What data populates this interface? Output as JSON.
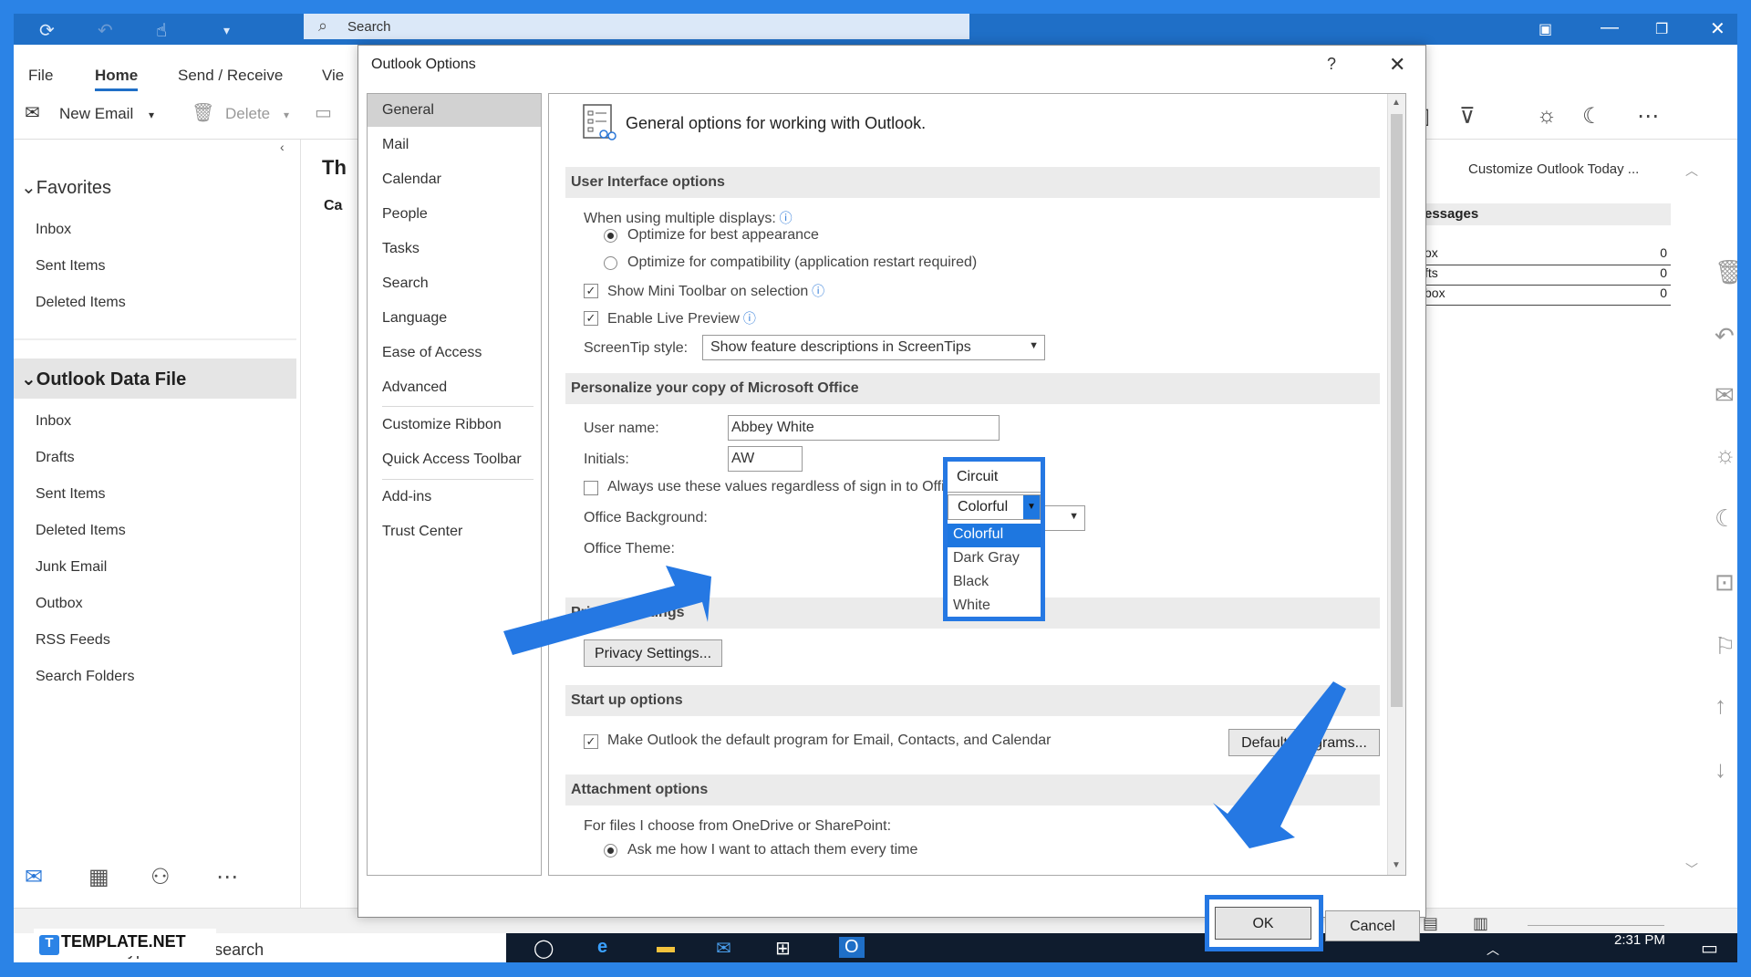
{
  "titlebar": {
    "search_placeholder": "Search"
  },
  "ribbon": {
    "tabs": [
      "File",
      "Home",
      "Send / Receive",
      "Vie"
    ],
    "new_email": "New Email",
    "delete": "Delete"
  },
  "folders": {
    "favorites_header": "Favorites",
    "favorites": [
      "Inbox",
      "Sent Items",
      "Deleted Items"
    ],
    "data_file_header": "Outlook Data File",
    "data_file_items": [
      "Inbox",
      "Drafts",
      "Sent Items",
      "Deleted Items",
      "Junk Email",
      "Outbox",
      "RSS Feeds",
      "Search Folders"
    ]
  },
  "midpane": {
    "title_fragment": "Th",
    "label_fragment": "Ca"
  },
  "rightpane": {
    "customize": "Customize Outlook Today ...",
    "messages_header": "essages",
    "rows": [
      {
        "label": "ox",
        "value": "0"
      },
      {
        "label": "fts",
        "value": "0"
      },
      {
        "label": "box",
        "value": "0"
      }
    ]
  },
  "dialog": {
    "title": "Outlook Options",
    "help": "?",
    "close": "✕",
    "nav": [
      "General",
      "Mail",
      "Calendar",
      "People",
      "Tasks",
      "Search",
      "Language",
      "Ease of Access",
      "Advanced",
      "Customize Ribbon",
      "Quick Access Toolbar",
      "Add-ins",
      "Trust Center"
    ],
    "header": "General options for working with Outlook.",
    "ui_section": "User Interface options",
    "multiple_displays": "When using multiple displays:",
    "opt_best": "Optimize for best appearance",
    "opt_compat": "Optimize for compatibility (application restart required)",
    "mini_toolbar": "Show Mini Toolbar on selection",
    "live_preview": "Enable Live Preview",
    "screentip_label": "ScreenTip style:",
    "screentip_value": "Show feature descriptions in ScreenTips",
    "personalize_section": "Personalize your copy of Microsoft Office",
    "username_label": "User name:",
    "username_value": "Abbey White",
    "initials_label": "Initials:",
    "initials_value": "AW",
    "always_use": "Always use these values regardless of sign in to Office.",
    "bg_label": "Office Background:",
    "bg_value": "Circuit",
    "theme_label": "Office Theme:",
    "theme_value": "Colorful",
    "theme_options": [
      "Colorful",
      "Dark Gray",
      "Black",
      "White"
    ],
    "privacy_section": "Privacy Settings",
    "privacy_button": "Privacy Settings...",
    "startup_section": "Start up options",
    "default_program": "Make Outlook the default program for Email, Contacts, and Calendar",
    "default_programs_button": "Default Programs...",
    "attachment_section": "Attachment options",
    "onedrive_label": "For files I choose from OneDrive or SharePoint:",
    "ask_me": "Ask me how I want to attach them every time",
    "ok": "OK",
    "cancel": "Cancel"
  },
  "taskbar": {
    "search": "Type here to search",
    "time": "2:31 PM"
  },
  "watermark": {
    "brand": "TEMPLATE.NET"
  },
  "colors": {
    "accent": "#2578e3",
    "title_blue": "#1f6fc7",
    "selection": "#1e77e0"
  }
}
